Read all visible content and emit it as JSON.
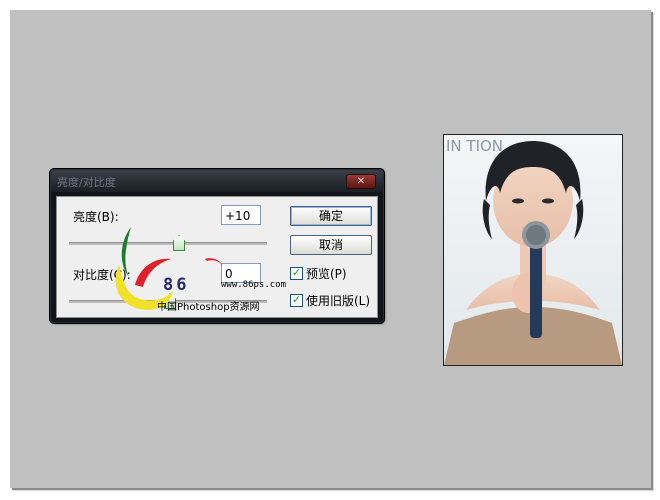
{
  "dialog": {
    "title": "亮度/对比度",
    "close_label": "✕",
    "brightness": {
      "label": "亮度(B):",
      "value": "+10",
      "level": 0.55
    },
    "contrast": {
      "label": "对比度(C):",
      "value": "0",
      "level": 0.5
    },
    "ok_label": "确定",
    "cancel_label": "取消",
    "preview": {
      "label": "预览(P)",
      "checked": true
    },
    "legacy": {
      "label": "使用旧版(L)",
      "checked": true
    }
  },
  "watermark": {
    "number": "86",
    "url": "www.86ps.com",
    "caption": "中国Photoshop资源网"
  },
  "photo": {
    "backdrop_text": "IN    TION"
  },
  "colors": {
    "canvas": "#c0c0c0",
    "dialog_frame": "#111418",
    "dialog_body": "#efefef",
    "thumb": "#3a8a3a"
  }
}
